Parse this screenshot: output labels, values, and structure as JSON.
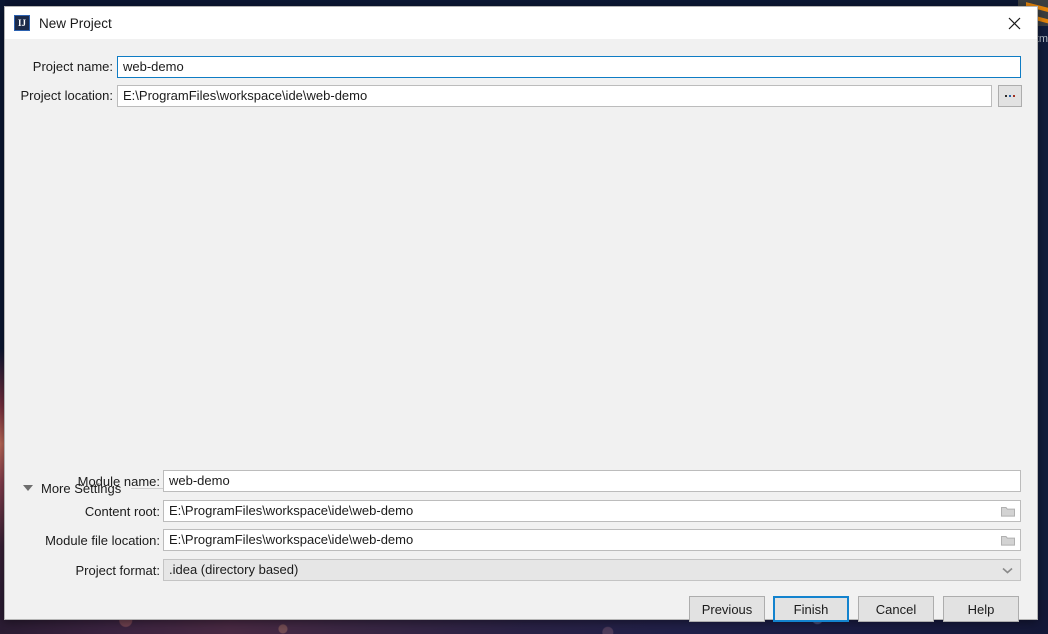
{
  "background": {
    "file_tree_label": "htm",
    "logo_icon": "intellij-stripes-icon"
  },
  "dialog": {
    "title": "New Project",
    "app_icon": "intellij-idea-icon",
    "close_icon": "close-icon",
    "fields": {
      "project_name": {
        "label": "Project name:",
        "value": "web-demo",
        "placeholder": ""
      },
      "project_location": {
        "label": "Project location:",
        "value": "E:\\ProgramFiles\\workspace\\ide\\web-demo",
        "placeholder": "",
        "browse_label": "..."
      }
    },
    "more_settings": {
      "label": "More Settings",
      "expanded": true,
      "toggle_icon": "chevron-down-icon",
      "fields": {
        "module_name": {
          "label": "Module name:",
          "value": "web-demo",
          "placeholder": ""
        },
        "content_root": {
          "label": "Content root:",
          "value": "E:\\ProgramFiles\\workspace\\ide\\web-demo",
          "placeholder": "",
          "browse_icon": "folder-icon"
        },
        "module_file_location": {
          "label": "Module file location:",
          "value": "E:\\ProgramFiles\\workspace\\ide\\web-demo",
          "placeholder": "",
          "browse_icon": "folder-icon"
        },
        "project_format": {
          "label": "Project format:",
          "value": ".idea (directory based)",
          "dropdown_icon": "chevron-down-icon"
        }
      }
    },
    "buttons": {
      "previous": "Previous",
      "finish": "Finish",
      "cancel": "Cancel",
      "help": "Help"
    },
    "colors": {
      "accent": "#1383ce",
      "focus_border": "#0f7cc4",
      "dialog_bg": "#f1f1f1",
      "titlebar_bg": "#ffffff"
    }
  }
}
